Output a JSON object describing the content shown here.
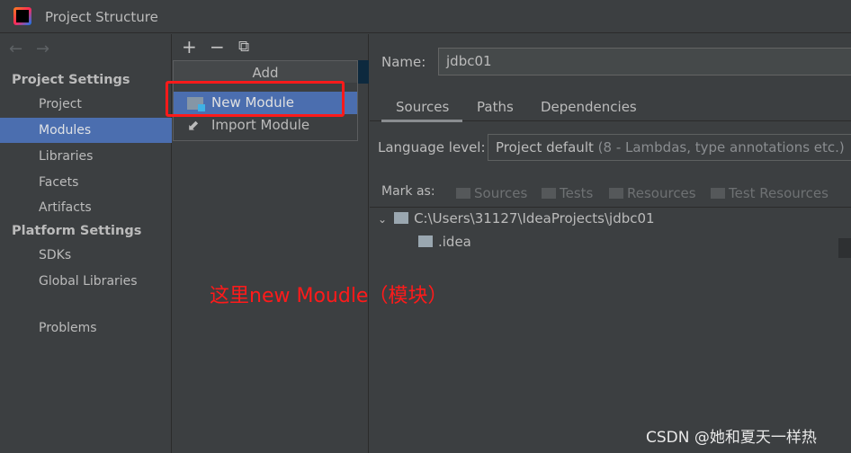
{
  "window": {
    "title": "Project Structure"
  },
  "sidebar": {
    "section1": "Project Settings",
    "items1": [
      "Project",
      "Modules",
      "Libraries",
      "Facets",
      "Artifacts"
    ],
    "section2": "Platform Settings",
    "items2": [
      "SDKs",
      "Global Libraries"
    ],
    "problems": "Problems",
    "selected": "Modules"
  },
  "toolbar": {
    "add": "+",
    "remove": "−",
    "copy": "⧉"
  },
  "popup": {
    "header": "Add",
    "items": [
      "New Module",
      "Import Module"
    ],
    "selected": "New Module"
  },
  "details": {
    "name_label": "Name:",
    "name_value": "jdbc01",
    "tabs": [
      "Sources",
      "Paths",
      "Dependencies"
    ],
    "active_tab": "Sources",
    "lang_label": "Language level:",
    "lang_value": "Project default",
    "lang_hint": "(8 - Lambdas, type annotations etc.)",
    "mark_label": "Mark as:",
    "mark_items": [
      "Sources",
      "Tests",
      "Resources",
      "Test Resources"
    ],
    "tree": [
      "C:\\Users\\31127\\IdeaProjects\\jdbc01",
      ".idea"
    ]
  },
  "annotation": "这里new Moudle（模块）",
  "watermark": "CSDN @她和夏天一样热",
  "colors": {
    "selection": "#4b6eaf",
    "annotation": "#ff1a1a",
    "background": "#3c3f41"
  }
}
